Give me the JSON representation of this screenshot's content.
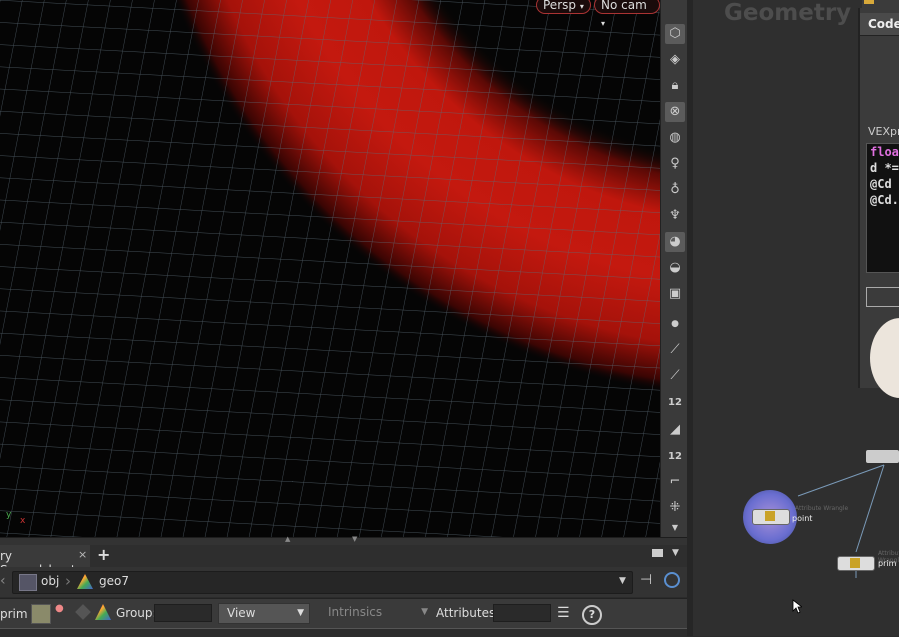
{
  "viewport": {
    "persp_menu": "Persp",
    "cam_menu": "No cam",
    "axis_y": "y",
    "axis_x": "x",
    "toolbar_numbers": [
      "12",
      "12"
    ]
  },
  "pane_tab": {
    "label": "ry Spreadsheet",
    "close": "×",
    "add": "+"
  },
  "path": {
    "root": "obj",
    "node": "geo7"
  },
  "filter": {
    "mode": "prim",
    "group_label": "Group:",
    "group_value": "",
    "view_label": "View",
    "intrinsics_label": "Intrinsics",
    "attributes_label": "Attributes:",
    "attributes_value": "",
    "help": "?"
  },
  "network": {
    "title": "Geometry",
    "nodes": [
      {
        "type": "Attribute Wrangle",
        "name": "point"
      },
      {
        "type": "Attribute Wrangle",
        "name": "prim"
      }
    ]
  },
  "params": {
    "tab_code": "Code",
    "vex_label": "VEXpr",
    "code_lines": [
      "floa",
      "d *=",
      "@Cd",
      "@Cd."
    ]
  },
  "colors": {
    "tube_red": "#c4190f",
    "grid": "#5b6b75",
    "node_selected": "#6a6ed0",
    "vex_keyword": "#e070e0"
  }
}
